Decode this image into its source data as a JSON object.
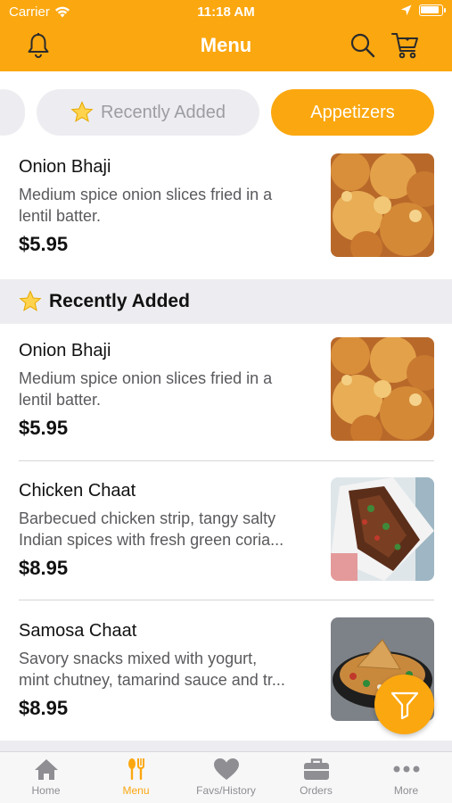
{
  "status": {
    "carrier": "Carrier",
    "time": "11:18 AM"
  },
  "nav": {
    "title": "Menu"
  },
  "chips": [
    {
      "label": "Recently Added",
      "icon": "star-icon",
      "selected": false
    },
    {
      "label": "Appetizers",
      "selected": true
    }
  ],
  "items": [
    {
      "name": "Onion Bhaji",
      "desc": [
        "Medium spice onion slices fried in a",
        "lentil batter."
      ],
      "price": "$5.95"
    },
    {
      "name": "Onion Bhaji",
      "desc": [
        "Medium spice onion slices fried in a",
        "lentil batter."
      ],
      "price": "$5.95"
    },
    {
      "name": "Chicken Chaat",
      "desc": [
        "Barbecued chicken strip, tangy salty",
        "Indian spices with fresh green coria..."
      ],
      "price": "$8.95"
    },
    {
      "name": "Samosa Chaat",
      "desc": [
        "Savory snacks mixed with yogurt,",
        "mint chutney, tamarind sauce and tr..."
      ],
      "price": "$8.95"
    }
  ],
  "section": {
    "title": "Recently Added",
    "icon": "star-icon"
  },
  "tabs": [
    {
      "label": "Home",
      "icon": "home-icon",
      "active": false
    },
    {
      "label": "Menu",
      "icon": "fork-spoon-icon",
      "active": true
    },
    {
      "label": "Favs/History",
      "icon": "heart-icon",
      "active": false
    },
    {
      "label": "Orders",
      "icon": "briefcase-icon",
      "active": false
    },
    {
      "label": "More",
      "icon": "ellipsis-icon",
      "active": false
    }
  ],
  "colors": {
    "accent": "#fba70f",
    "chip_bg": "#ededf1",
    "inactive": "#8e8e93"
  }
}
